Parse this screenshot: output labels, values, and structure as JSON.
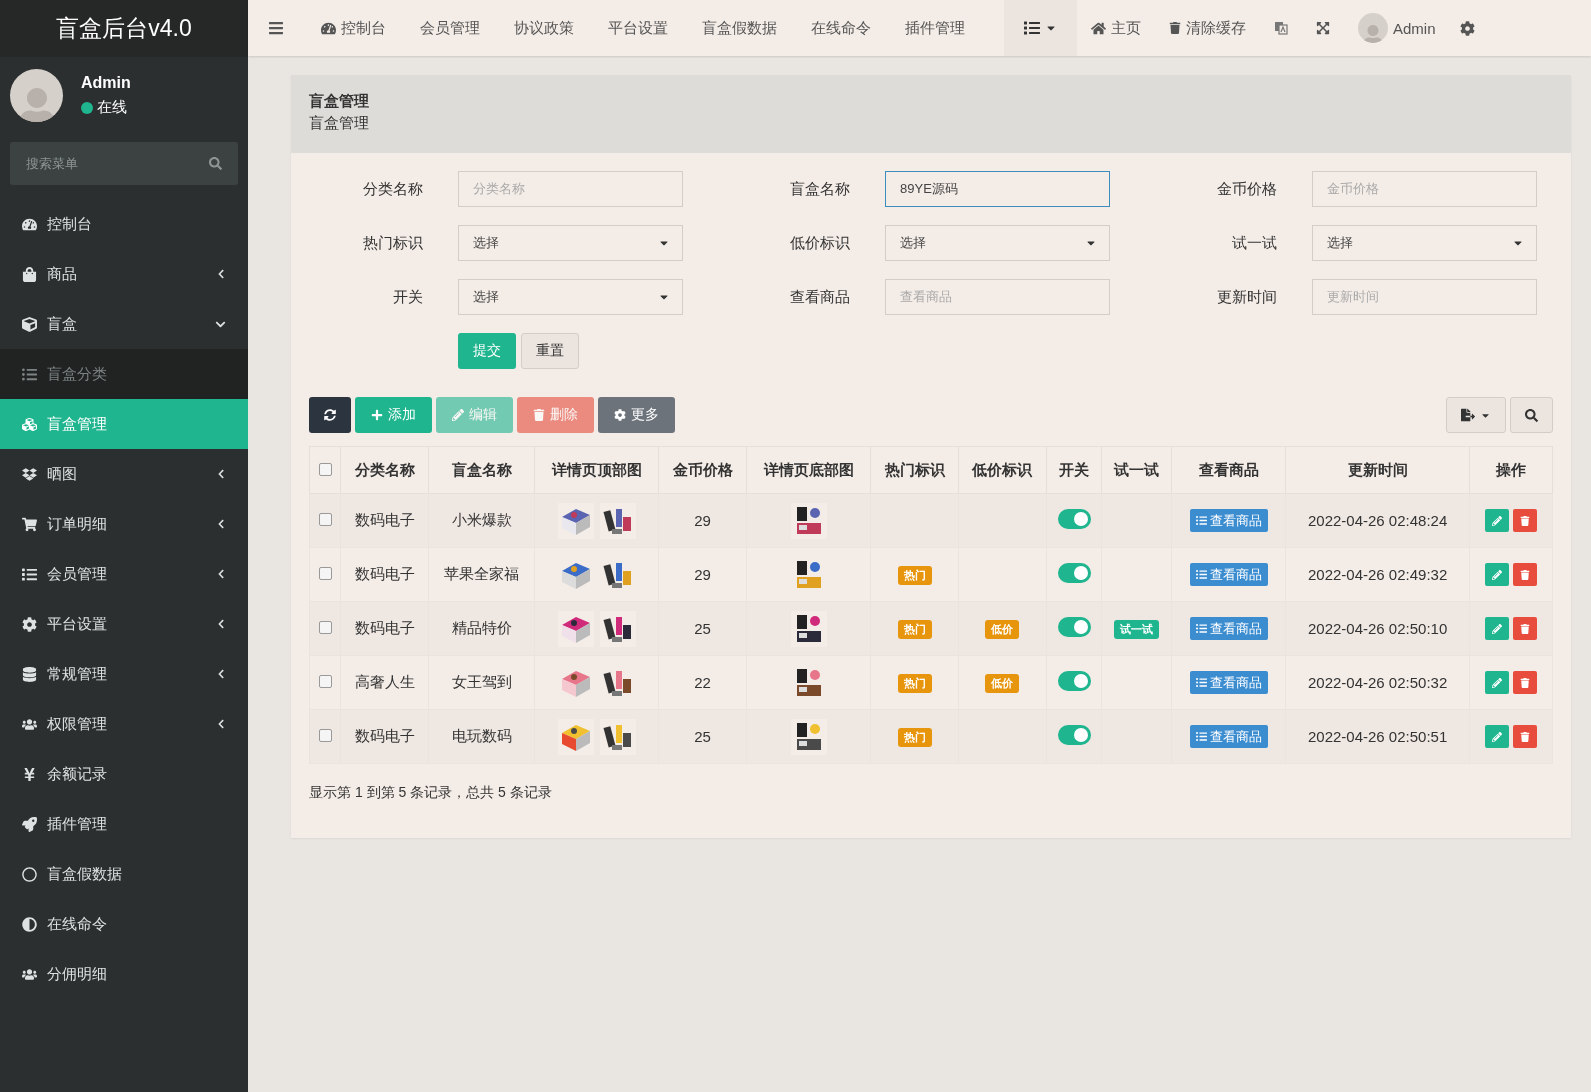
{
  "sidebar": {
    "logo": "盲盒后台v4.0",
    "user": {
      "name": "Admin",
      "status": "在线",
      "online": true
    },
    "search": {
      "placeholder": "搜索菜单"
    },
    "items": [
      {
        "label": "控制台",
        "selected": false
      },
      {
        "label": "商品",
        "selected": false,
        "expanded": false
      },
      {
        "label": "盲盒",
        "selected": false,
        "expanded": true,
        "children": [
          {
            "label": "盲盒分类",
            "selected": false
          },
          {
            "label": "盲盒管理",
            "selected": true
          }
        ]
      },
      {
        "label": "晒图",
        "selected": false,
        "expanded": false
      },
      {
        "label": "订单明细",
        "selected": false,
        "expanded": false
      },
      {
        "label": "会员管理",
        "selected": false,
        "expanded": false
      },
      {
        "label": "平台设置",
        "selected": false,
        "expanded": false
      },
      {
        "label": "常规管理",
        "selected": false,
        "expanded": false
      },
      {
        "label": "权限管理",
        "selected": false,
        "expanded": false
      },
      {
        "label": "余额记录",
        "selected": false
      },
      {
        "label": "插件管理",
        "selected": false
      },
      {
        "label": "盲盒假数据",
        "selected": false
      },
      {
        "label": "在线命令",
        "selected": false
      },
      {
        "label": "分佣明细",
        "selected": false
      }
    ]
  },
  "topbar": {
    "nav": [
      "控制台",
      "会员管理",
      "协议政策",
      "平台设置",
      "盲盒假数据",
      "在线命令",
      "插件管理"
    ],
    "home": "主页",
    "clear_cache": "清除缓存",
    "user": "Admin"
  },
  "panel": {
    "title": "盲盒管理",
    "subtitle": "盲盒管理",
    "form": [
      {
        "label": "分类名称",
        "kind": "input",
        "placeholder": "分类名称"
      },
      {
        "label": "盲盒名称",
        "kind": "input",
        "value": "89YE源码",
        "focused": true
      },
      {
        "label": "金币价格",
        "kind": "input",
        "placeholder": "金币价格"
      },
      {
        "label": "热门标识",
        "kind": "select",
        "value": "选择"
      },
      {
        "label": "低价标识",
        "kind": "select",
        "value": "选择"
      },
      {
        "label": "试一试",
        "kind": "select",
        "value": "选择"
      },
      {
        "label": "开关",
        "kind": "select",
        "value": "选择"
      },
      {
        "label": "查看商品",
        "kind": "input",
        "placeholder": "查看商品"
      },
      {
        "label": "更新时间",
        "kind": "input",
        "placeholder": "更新时间"
      }
    ],
    "form_buttons": [
      "提交",
      "重置"
    ],
    "toolbar": [
      {
        "kind": "refresh",
        "disabled": false
      },
      {
        "kind": "add",
        "label": "添加",
        "disabled": false
      },
      {
        "kind": "edit",
        "label": "编辑",
        "disabled": true
      },
      {
        "kind": "delete",
        "label": "删除",
        "disabled": true
      },
      {
        "kind": "more",
        "label": "更多",
        "disabled": false
      }
    ],
    "table": {
      "columns": [
        "分类名称",
        "盲盒名称",
        "详情页顶部图",
        "金币价格",
        "详情页底部图",
        "热门标识",
        "低价标识",
        "开关",
        "试一试",
        "查看商品",
        "更新时间",
        "操作"
      ],
      "select_all_checked": false,
      "rows": [
        {
          "checked": false,
          "category": "数码电子",
          "name": "小米爆款",
          "price": "29",
          "on": true,
          "view": "查看商品",
          "updated": "2022-04-26 02:48:24"
        },
        {
          "checked": false,
          "category": "数码电子",
          "name": "苹果全家福",
          "price": "29",
          "hot": "热门",
          "on": true,
          "view": "查看商品",
          "updated": "2022-04-26 02:49:32"
        },
        {
          "checked": false,
          "category": "数码电子",
          "name": "精品特价",
          "price": "25",
          "hot": "热门",
          "low": "低价",
          "on": true,
          "try": "试一试",
          "view": "查看商品",
          "updated": "2022-04-26 02:50:10"
        },
        {
          "checked": false,
          "category": "高奢人生",
          "name": "女王驾到",
          "price": "22",
          "hot": "热门",
          "low": "低价",
          "on": true,
          "view": "查看商品",
          "updated": "2022-04-26 02:50:32"
        },
        {
          "checked": false,
          "category": "数码电子",
          "name": "电玩数码",
          "price": "25",
          "hot": "热门",
          "on": true,
          "view": "查看商品",
          "updated": "2022-04-26 02:50:51"
        }
      ]
    },
    "footer": "显示第 1 到第 5 条记录，总共 5 条记录"
  }
}
